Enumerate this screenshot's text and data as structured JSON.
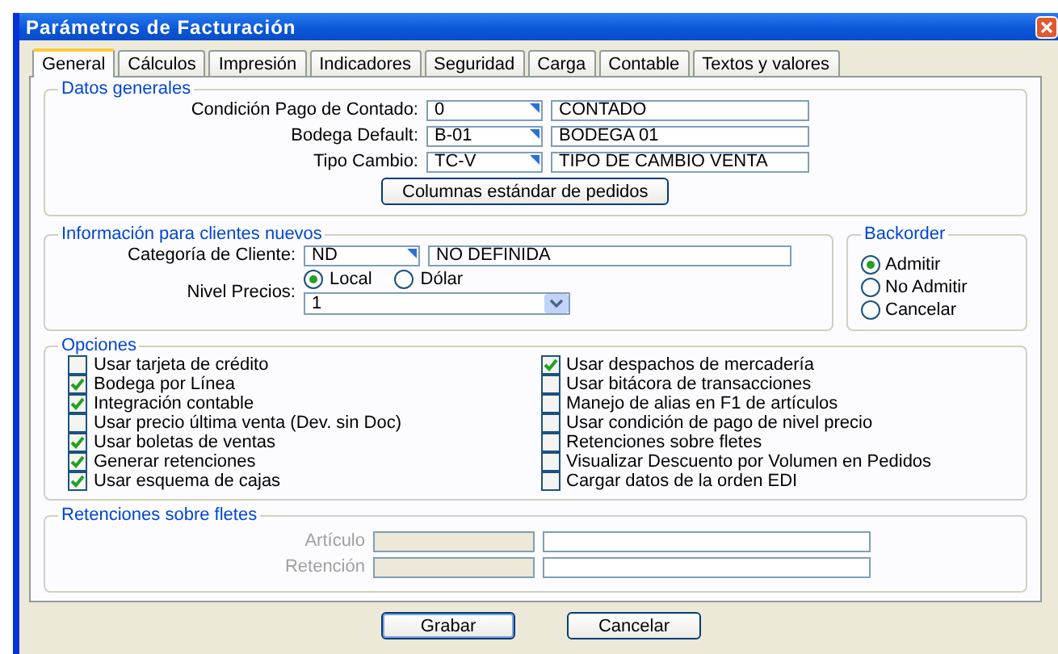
{
  "window": {
    "title": "Parámetros de Facturación"
  },
  "tabs": [
    {
      "label": "General",
      "selected": true
    },
    {
      "label": "Cálculos",
      "selected": false
    },
    {
      "label": "Impresión",
      "selected": false
    },
    {
      "label": "Indicadores",
      "selected": false
    },
    {
      "label": "Seguridad",
      "selected": false
    },
    {
      "label": "Carga",
      "selected": false
    },
    {
      "label": "Contable",
      "selected": false
    },
    {
      "label": "Textos y valores",
      "selected": false
    }
  ],
  "datos_generales": {
    "title": "Datos generales",
    "fields": [
      {
        "label": "Condición Pago de Contado:",
        "code": "0",
        "description": "CONTADO"
      },
      {
        "label": "Bodega Default:",
        "code": "B-01",
        "description": "BODEGA 01"
      },
      {
        "label": "Tipo Cambio:",
        "code": "TC-V",
        "description": "TIPO DE CAMBIO VENTA"
      }
    ],
    "button": "Columnas estándar de pedidos"
  },
  "clientes_nuevos": {
    "title": "Información para clientes nuevos",
    "categoria": {
      "label": "Categoría de Cliente:",
      "code": "ND",
      "description": "NO DEFINIDA"
    },
    "nivel_precios": {
      "label": "Nivel Precios:",
      "options": [
        {
          "label": "Local",
          "selected": true
        },
        {
          "label": "Dólar",
          "selected": false
        }
      ],
      "value": "1"
    }
  },
  "backorder": {
    "title": "Backorder",
    "options": [
      {
        "label": "Admitir",
        "selected": true
      },
      {
        "label": "No Admitir",
        "selected": false
      },
      {
        "label": "Cancelar",
        "selected": false
      }
    ]
  },
  "opciones": {
    "title": "Opciones",
    "items": [
      {
        "label": "Usar tarjeta de crédito",
        "checked": false
      },
      {
        "label": "Bodega por Línea",
        "checked": true
      },
      {
        "label": "Integración contable",
        "checked": true
      },
      {
        "label": "Usar precio última venta (Dev. sin Doc)",
        "checked": false
      },
      {
        "label": "Usar boletas de ventas",
        "checked": true
      },
      {
        "label": "Generar retenciones",
        "checked": true
      },
      {
        "label": "Usar esquema de cajas",
        "checked": true
      },
      {
        "label": "Usar despachos de mercadería",
        "checked": true
      },
      {
        "label": "Usar bitácora de transacciones",
        "checked": false
      },
      {
        "label": "Manejo de alias en F1 de artículos",
        "checked": false
      },
      {
        "label": "Usar condición de pago de nivel precio",
        "checked": false
      },
      {
        "label": "Retenciones sobre fletes",
        "checked": false
      },
      {
        "label": "Visualizar Descuento por Volumen en Pedidos",
        "checked": false
      },
      {
        "label": "Cargar datos de la orden EDI",
        "checked": false
      }
    ]
  },
  "retenciones": {
    "title": "Retenciones sobre fletes",
    "fields": [
      {
        "label": "Artículo",
        "disabled": true
      },
      {
        "label": "Retención",
        "disabled": true
      }
    ]
  },
  "buttons": [
    {
      "label": "Grabar",
      "default": true
    },
    {
      "label": "Cancelar",
      "default": false
    }
  ]
}
